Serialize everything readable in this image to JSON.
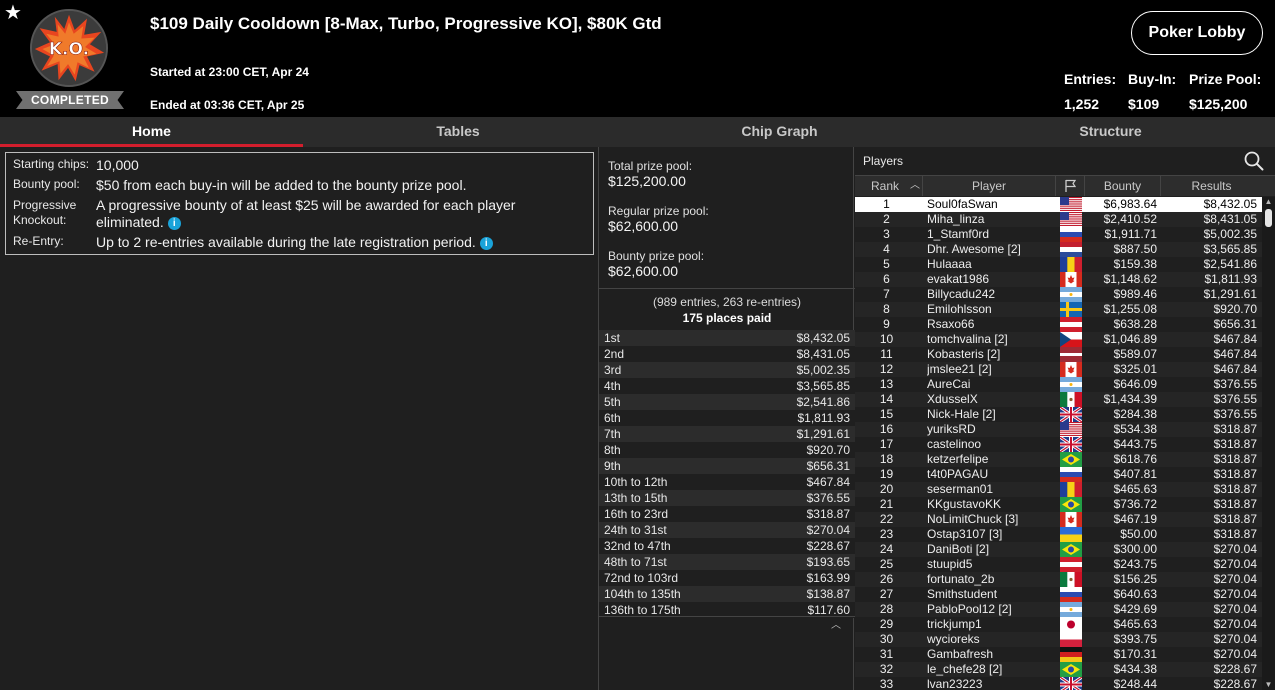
{
  "header": {
    "star": "★",
    "logo_text": "K.O.",
    "status_badge": "COMPLETED",
    "title": "$109 Daily Cooldown [8-Max, Turbo, Progressive KO], $80K Gtd",
    "started": "Started at 23:00 CET, Apr 24",
    "ended": "Ended at 03:36 CET, Apr 25",
    "lobby_button": "Poker Lobby",
    "entries_label": "Entries:",
    "entries_value": "1,252",
    "buyin_label": "Buy-In:",
    "buyin_value": "$109",
    "prizepool_label": "Prize Pool:",
    "prizepool_value": "$125,200"
  },
  "tabs": [
    {
      "label": "Home",
      "active": true
    },
    {
      "label": "Tables",
      "active": false
    },
    {
      "label": "Chip Graph",
      "active": false
    },
    {
      "label": "Structure",
      "active": false
    }
  ],
  "info": {
    "starting_chips_label": "Starting chips:",
    "starting_chips_value": "10,000",
    "bounty_pool_label": "Bounty pool:",
    "bounty_pool_value": "$50 from each buy-in will be added to the bounty prize pool.",
    "progressive_label": "Progressive Knockout:",
    "progressive_value": "A progressive bounty of at least $25 will be awarded for each player eliminated.",
    "reentry_label": "Re-Entry:",
    "reentry_value": "Up to 2 re-entries available during the late registration period."
  },
  "prize": {
    "total_label": "Total prize pool:",
    "total_value": "$125,200.00",
    "regular_label": "Regular prize pool:",
    "regular_value": "$62,600.00",
    "bounty_label": "Bounty prize pool:",
    "bounty_value": "$62,600.00",
    "entries_line": "(989 entries, 263 re-entries)",
    "places_paid": "175 places paid",
    "payouts": [
      {
        "place": "1st",
        "amount": "$8,432.05"
      },
      {
        "place": "2nd",
        "amount": "$8,431.05"
      },
      {
        "place": "3rd",
        "amount": "$5,002.35"
      },
      {
        "place": "4th",
        "amount": "$3,565.85"
      },
      {
        "place": "5th",
        "amount": "$2,541.86"
      },
      {
        "place": "6th",
        "amount": "$1,811.93"
      },
      {
        "place": "7th",
        "amount": "$1,291.61"
      },
      {
        "place": "8th",
        "amount": "$920.70"
      },
      {
        "place": "9th",
        "amount": "$656.31"
      },
      {
        "place": "10th to 12th",
        "amount": "$467.84"
      },
      {
        "place": "13th to 15th",
        "amount": "$376.55"
      },
      {
        "place": "16th to 23rd",
        "amount": "$318.87"
      },
      {
        "place": "24th to 31st",
        "amount": "$270.04"
      },
      {
        "place": "32nd to 47th",
        "amount": "$228.67"
      },
      {
        "place": "48th to 71st",
        "amount": "$193.65"
      },
      {
        "place": "72nd to 103rd",
        "amount": "$163.99"
      },
      {
        "place": "104th to 135th",
        "amount": "$138.87"
      },
      {
        "place": "136th to 175th",
        "amount": "$117.60"
      }
    ]
  },
  "players": {
    "title": "Players",
    "columns": {
      "rank": "Rank",
      "player": "Player",
      "bounty": "Bounty",
      "results": "Results"
    },
    "rows": [
      {
        "rank": "1",
        "name": "Soul0faSwan",
        "flag": "us",
        "bounty": "$6,983.64",
        "result": "$8,432.05",
        "selected": true
      },
      {
        "rank": "2",
        "name": "Miha_linza",
        "flag": "us",
        "bounty": "$2,410.52",
        "result": "$8,431.05"
      },
      {
        "rank": "3",
        "name": "1_Stamf0rd",
        "flag": "ru",
        "bounty": "$1,911.71",
        "result": "$5,002.35"
      },
      {
        "rank": "4",
        "name": "Dhr. Awesome [2]",
        "flag": "nl",
        "bounty": "$887.50",
        "result": "$3,565.85"
      },
      {
        "rank": "5",
        "name": "Hulaaaa",
        "flag": "ro",
        "bounty": "$159.38",
        "result": "$2,541.86"
      },
      {
        "rank": "6",
        "name": "evakat1986",
        "flag": "ca",
        "bounty": "$1,148.62",
        "result": "$1,811.93"
      },
      {
        "rank": "7",
        "name": "Billycadu242",
        "flag": "ar",
        "bounty": "$989.46",
        "result": "$1,291.61"
      },
      {
        "rank": "8",
        "name": "Emilohlsson",
        "flag": "se",
        "bounty": "$1,255.08",
        "result": "$920.70"
      },
      {
        "rank": "9",
        "name": "Rsaxo66",
        "flag": "at",
        "bounty": "$638.28",
        "result": "$656.31"
      },
      {
        "rank": "10",
        "name": "tomchvalina [2]",
        "flag": "cz",
        "bounty": "$1,046.89",
        "result": "$467.84"
      },
      {
        "rank": "11",
        "name": "Kobasteris [2]",
        "flag": "lv",
        "bounty": "$589.07",
        "result": "$467.84"
      },
      {
        "rank": "12",
        "name": "jmslee21 [2]",
        "flag": "ca",
        "bounty": "$325.01",
        "result": "$467.84"
      },
      {
        "rank": "13",
        "name": "AureCai",
        "flag": "ar",
        "bounty": "$646.09",
        "result": "$376.55"
      },
      {
        "rank": "14",
        "name": "XdusselX",
        "flag": "mx",
        "bounty": "$1,434.39",
        "result": "$376.55"
      },
      {
        "rank": "15",
        "name": "Nick-Hale [2]",
        "flag": "gb",
        "bounty": "$284.38",
        "result": "$376.55"
      },
      {
        "rank": "16",
        "name": "yuriksRD",
        "flag": "us",
        "bounty": "$534.38",
        "result": "$318.87"
      },
      {
        "rank": "17",
        "name": "castelinoo",
        "flag": "gb",
        "bounty": "$443.75",
        "result": "$318.87"
      },
      {
        "rank": "18",
        "name": "ketzerfelipe",
        "flag": "br",
        "bounty": "$618.76",
        "result": "$318.87"
      },
      {
        "rank": "19",
        "name": "t4t0PAGAU",
        "flag": "ru",
        "bounty": "$407.81",
        "result": "$318.87"
      },
      {
        "rank": "20",
        "name": "seserman01",
        "flag": "ro",
        "bounty": "$465.63",
        "result": "$318.87"
      },
      {
        "rank": "21",
        "name": "KKgustavoKK",
        "flag": "br",
        "bounty": "$736.72",
        "result": "$318.87"
      },
      {
        "rank": "22",
        "name": "NoLimitChuck [3]",
        "flag": "ca",
        "bounty": "$467.19",
        "result": "$318.87"
      },
      {
        "rank": "23",
        "name": "Ostap3107 [3]",
        "flag": "ua",
        "bounty": "$50.00",
        "result": "$318.87"
      },
      {
        "rank": "24",
        "name": "DaniBoti [2]",
        "flag": "br",
        "bounty": "$300.00",
        "result": "$270.04"
      },
      {
        "rank": "25",
        "name": "stuupid5",
        "flag": "at",
        "bounty": "$243.75",
        "result": "$270.04"
      },
      {
        "rank": "26",
        "name": "fortunato_2b",
        "flag": "mx",
        "bounty": "$156.25",
        "result": "$270.04"
      },
      {
        "rank": "27",
        "name": "Smithstudent",
        "flag": "ru",
        "bounty": "$640.63",
        "result": "$270.04"
      },
      {
        "rank": "28",
        "name": "PabloPool12 [2]",
        "flag": "ar",
        "bounty": "$429.69",
        "result": "$270.04"
      },
      {
        "rank": "29",
        "name": "trickjump1",
        "flag": "jp",
        "bounty": "$465.63",
        "result": "$270.04"
      },
      {
        "rank": "30",
        "name": "wycioreks",
        "flag": "pl",
        "bounty": "$393.75",
        "result": "$270.04"
      },
      {
        "rank": "31",
        "name": "Gambafresh",
        "flag": "de",
        "bounty": "$170.31",
        "result": "$270.04"
      },
      {
        "rank": "32",
        "name": "le_chefe28 [2]",
        "flag": "br",
        "bounty": "$434.38",
        "result": "$228.67"
      },
      {
        "rank": "33",
        "name": "lvan23223",
        "flag": "gb",
        "bounty": "$248.44",
        "result": "$228.67"
      }
    ]
  },
  "colors": {
    "accent_red": "#d31e2d",
    "header_bg": "#000000",
    "panel_bg": "#1f1f1f",
    "info_icon": "#1aa3d9"
  }
}
